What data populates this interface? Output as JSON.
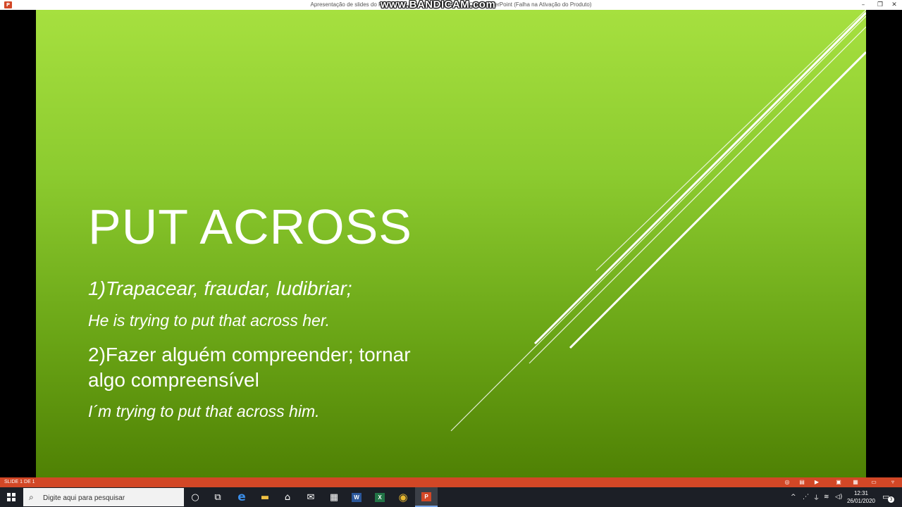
{
  "titlebar": {
    "app_icon_label": "P",
    "title": "Apresentação de slides do PowerPoint - [ACERTO ONES OFFICE] - PowerPoint (Falha na Ativação do Produto)",
    "watermark": "www.BANDICAM.com",
    "minimize": "–",
    "restore": "❐",
    "close": "✕"
  },
  "slide": {
    "title": "PUT ACROSS",
    "bullet1": "1)Trapacear, fraudar, ludibriar;",
    "example1": "He is trying to put that across her.",
    "bullet2_line1": "2)Fazer alguém compreender; tornar",
    "bullet2_line2": "algo compreensível",
    "example2": "I´m trying to put that across him.",
    "colors": {
      "gradient_top": "#a6e03f",
      "gradient_bottom": "#4f8104",
      "text": "#ffffff"
    }
  },
  "statusbar": {
    "slide_number": "SLIDE 1 DE 1",
    "color": "#d24726",
    "icons": [
      "presenter-icon",
      "notes-icon",
      "play-icon",
      "normal-view-icon",
      "slide-sorter-icon",
      "reading-view-icon",
      "fit-icon"
    ]
  },
  "taskbar": {
    "search_placeholder": "Digite aqui para pesquisar",
    "apps": [
      {
        "name": "cortana",
        "glyph": "○"
      },
      {
        "name": "task-view",
        "glyph": "⧉"
      },
      {
        "name": "edge",
        "glyph": "e"
      },
      {
        "name": "file-explorer",
        "glyph": "▬"
      },
      {
        "name": "store",
        "glyph": "⌂"
      },
      {
        "name": "mail",
        "glyph": "✉"
      },
      {
        "name": "calculator",
        "glyph": "▦"
      },
      {
        "name": "word",
        "glyph": "W"
      },
      {
        "name": "excel",
        "glyph": "X"
      },
      {
        "name": "chrome",
        "glyph": "◉"
      },
      {
        "name": "powerpoint",
        "glyph": "P"
      }
    ],
    "tray": {
      "chevron": "^",
      "time": "12:31",
      "date": "26/01/2020",
      "notifications": "3"
    }
  }
}
